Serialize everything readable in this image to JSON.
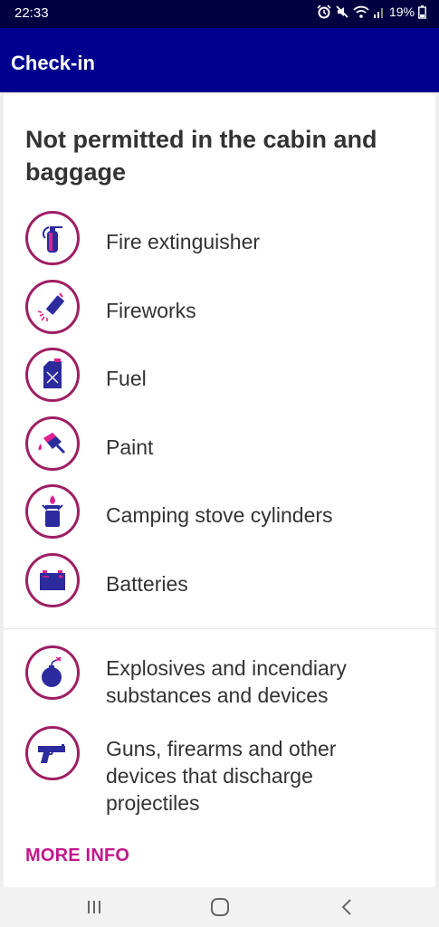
{
  "status_bar": {
    "time": "22:33",
    "battery": "19%"
  },
  "app_bar": {
    "title": "Check-in"
  },
  "section": {
    "heading": "Not permitted in the cabin and baggage"
  },
  "items_group1": [
    {
      "label": "Fire extinguisher",
      "icon": "fire-extinguisher-icon"
    },
    {
      "label": "Fireworks",
      "icon": "fireworks-icon"
    },
    {
      "label": "Fuel",
      "icon": "fuel-can-icon"
    },
    {
      "label": "Paint",
      "icon": "paint-icon"
    },
    {
      "label": "Camping stove cylinders",
      "icon": "camping-stove-icon"
    },
    {
      "label": "Batteries",
      "icon": "battery-icon"
    }
  ],
  "items_group2": [
    {
      "label": "Explosives and incendiary substances and devices",
      "icon": "bomb-icon"
    },
    {
      "label": "Guns, firearms and other devices that discharge projectiles",
      "icon": "gun-icon"
    }
  ],
  "more_info": "MORE INFO",
  "colors": {
    "app_bar": "#00008f",
    "status_bar": "#000041",
    "accent": "#c2168b",
    "icon_ring": "#9e1f63",
    "icon_fill": "#2b2b9e"
  }
}
